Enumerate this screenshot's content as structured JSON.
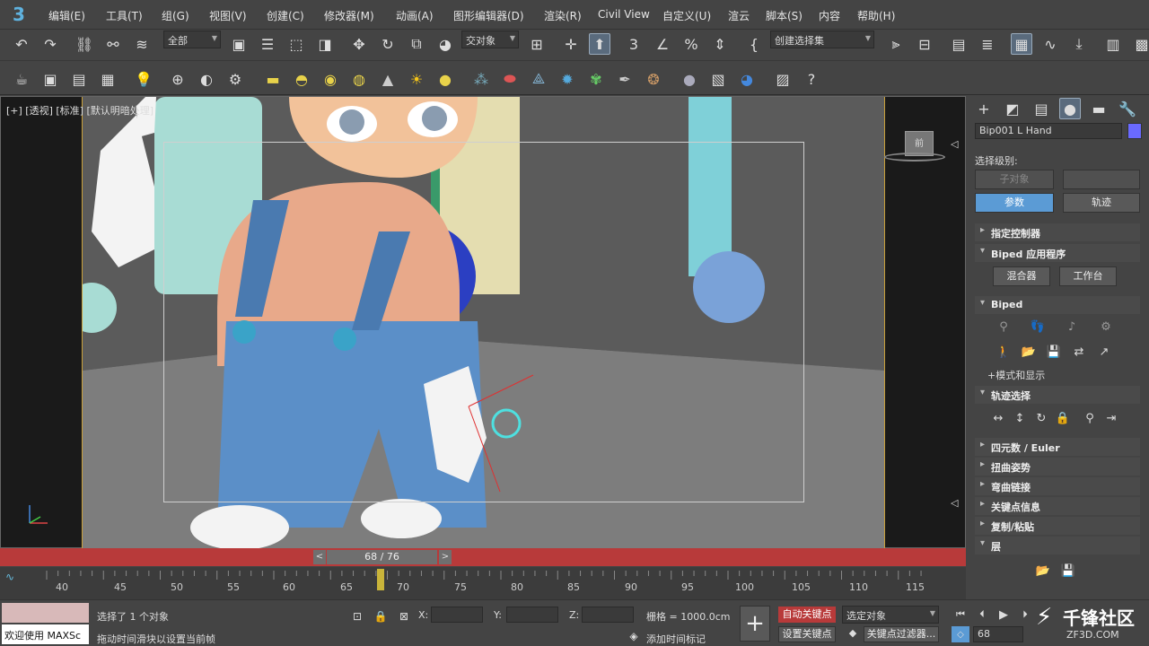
{
  "menu": [
    "编辑(E)",
    "工具(T)",
    "组(G)",
    "视图(V)",
    "创建(C)",
    "修改器(M)",
    "动画(A)",
    "图形编辑器(D)",
    "渲染(R)",
    "Civil View",
    "自定义(U)",
    "渲云",
    "脚本(S)",
    "内容",
    "帮助(H)"
  ],
  "toolbar": {
    "selection_filter": "全部",
    "ref_coord": "交对象",
    "named_selection": "创建选择集"
  },
  "viewport": {
    "label": "[+] [透视] [标准] [默认明暗处理]",
    "viewcube_label": "前"
  },
  "command_panel": {
    "object_name": "Bip001 L Hand",
    "object_color": "#6a6aff",
    "select_level_label": "选择级别:",
    "sub_object_btn": "子对象",
    "params_btn": "参数",
    "track_btn": "轨迹",
    "rollouts": {
      "assign_controller": "指定控制器",
      "biped_app": "Biped 应用程序",
      "mixer_btn": "混合器",
      "workbench_btn": "工作台",
      "biped": "Biped",
      "mode_display": "+模式和显示",
      "track_select": "轨迹选择",
      "quaternion": "四元数 / Euler",
      "twist_pose": "扭曲姿势",
      "bend_links": "弯曲链接",
      "key_info": "关键点信息",
      "copy_paste": "复制/粘贴",
      "layers": "层"
    }
  },
  "timeline": {
    "slider_label": "68 / 76",
    "ticks": [
      "40",
      "45",
      "50",
      "55",
      "60",
      "65",
      "70",
      "75",
      "80",
      "85",
      "90",
      "95",
      "100",
      "105",
      "110",
      "115"
    ]
  },
  "status": {
    "selected": "选择了 1 个对象",
    "prompt": "拖动时间滑块以设置当前帧",
    "welcome": "欢迎使用 MAXSc",
    "x_label": "X:",
    "y_label": "Y:",
    "z_label": "Z:",
    "grid": "栅格 = 1000.0cm",
    "add_time_tag": "添加时间标记",
    "auto_key": "自动关键点",
    "set_key": "设置关键点",
    "selected_obj": "选定对象",
    "key_filters": "关键点过滤器...",
    "frame": "68"
  },
  "watermark": {
    "title": "千锋社区",
    "url": "ZF3D.COM"
  }
}
